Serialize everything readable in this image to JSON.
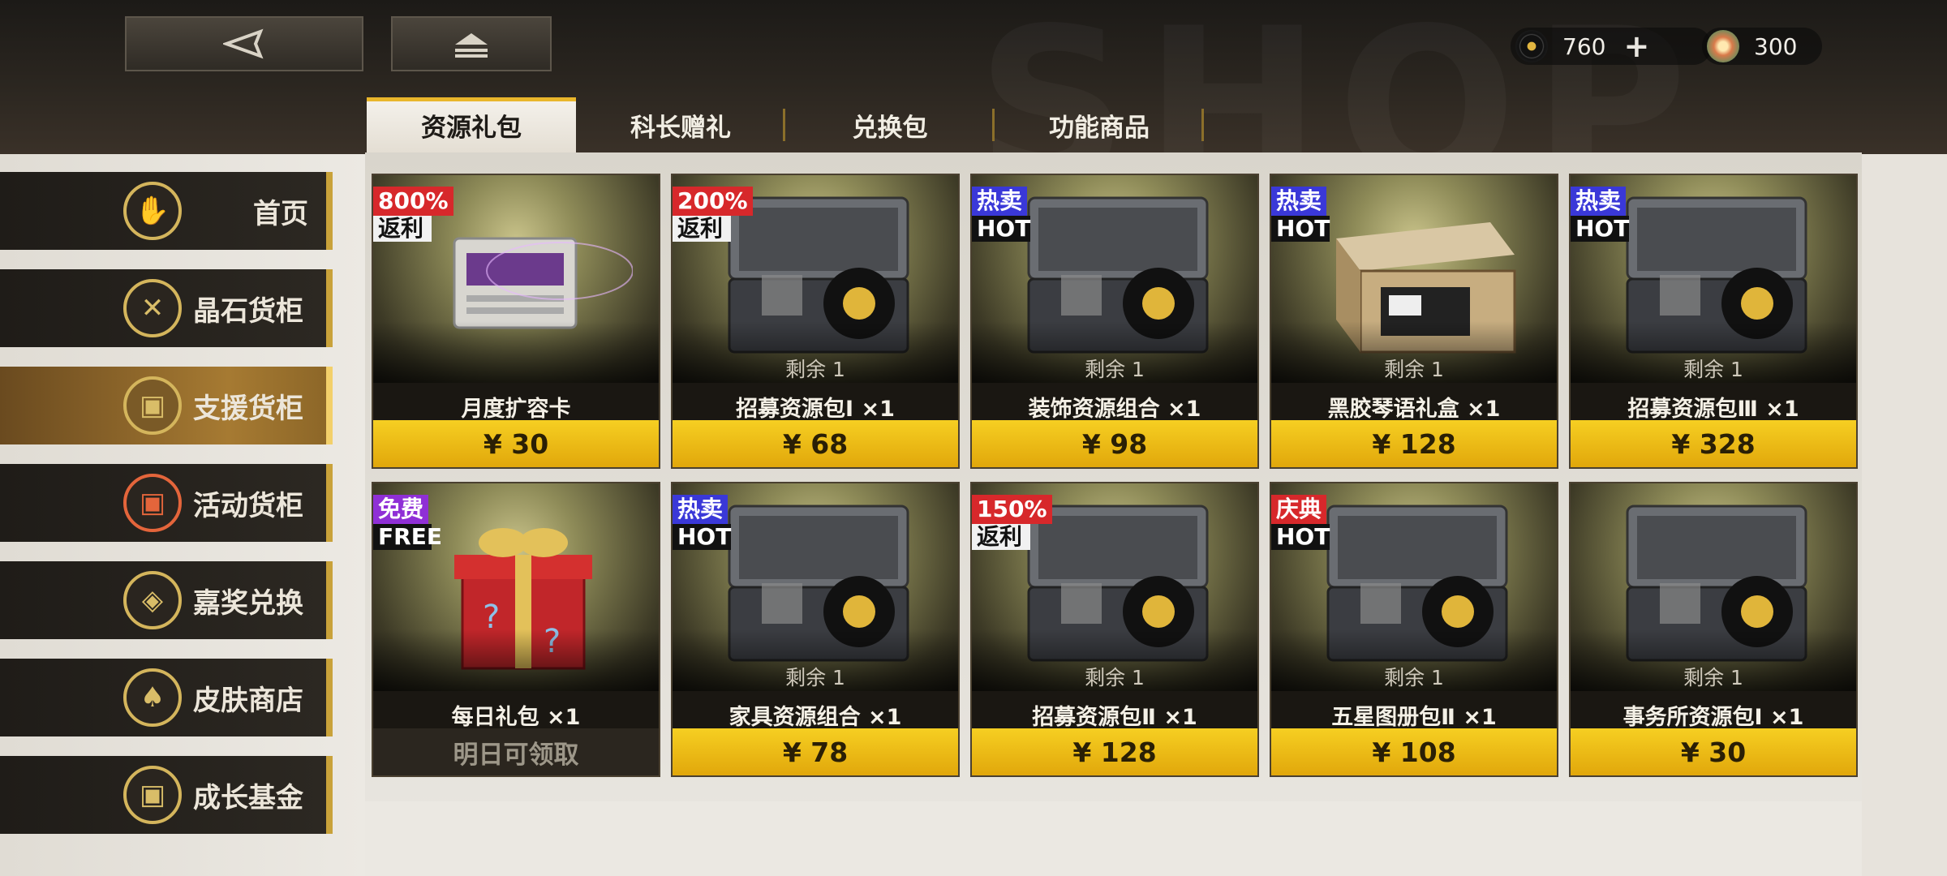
{
  "header": {
    "back_icon": "back-triangle-icon",
    "home_icon": "home-eject-icon",
    "bg_text": "SHOP",
    "currencies": [
      {
        "icon": "vinyl-record-icon",
        "value": "760",
        "plus": "+"
      },
      {
        "icon": "crystal-gem-icon",
        "value": "300"
      }
    ]
  },
  "tabs": [
    {
      "label": "资源礼包",
      "active": true
    },
    {
      "label": "科长赠礼",
      "active": false
    },
    {
      "label": "兑换包",
      "active": false
    },
    {
      "label": "功能商品",
      "active": false
    }
  ],
  "sidebar": {
    "items": [
      {
        "label": "首页",
        "icon": "home-hand-icon",
        "active": false
      },
      {
        "label": "晶石货柜",
        "icon": "crystal-cross-icon",
        "active": false
      },
      {
        "label": "支援货柜",
        "icon": "support-box-icon",
        "active": true
      },
      {
        "label": "活动货柜",
        "icon": "event-box-icon",
        "active": false
      },
      {
        "label": "嘉奖兑换",
        "icon": "reward-emblem-icon",
        "active": false
      },
      {
        "label": "皮肤商店",
        "icon": "suit-icon",
        "active": false
      },
      {
        "label": "成长基金",
        "icon": "fund-box-icon",
        "active": false
      }
    ]
  },
  "products": [
    {
      "badge_top": "800%",
      "badge_bottom": "返利",
      "badge_color": "red",
      "remaining": "",
      "name": "月度扩容卡",
      "price": "¥ 30",
      "art": "cartridge"
    },
    {
      "badge_top": "200%",
      "badge_bottom": "返利",
      "badge_color": "red",
      "remaining": "剩余 1",
      "name": "招募资源包Ⅰ ×1",
      "price": "¥ 68",
      "art": "case"
    },
    {
      "badge_top": "热卖",
      "badge_bottom": "HOT",
      "badge_color": "blue",
      "remaining": "剩余 1",
      "name": "装饰资源组合 ×1",
      "price": "¥ 98",
      "art": "case"
    },
    {
      "badge_top": "热卖",
      "badge_bottom": "HOT",
      "badge_color": "blue",
      "remaining": "剩余 1",
      "name": "黑胶琴语礼盒 ×1",
      "price": "¥ 128",
      "art": "box"
    },
    {
      "badge_top": "热卖",
      "badge_bottom": "HOT",
      "badge_color": "blue",
      "remaining": "剩余 1",
      "name": "招募资源包Ⅲ ×1",
      "price": "¥ 328",
      "art": "case"
    },
    {
      "badge_top": "免费",
      "badge_bottom": "FREE",
      "badge_color": "purple",
      "remaining": "",
      "name": "每日礼包 ×1",
      "price": "明日可领取",
      "art": "gift"
    },
    {
      "badge_top": "热卖",
      "badge_bottom": "HOT",
      "badge_color": "blue",
      "remaining": "剩余 1",
      "name": "家具资源组合 ×1",
      "price": "¥ 78",
      "art": "case"
    },
    {
      "badge_top": "150%",
      "badge_bottom": "返利",
      "badge_color": "red",
      "remaining": "剩余 1",
      "name": "招募资源包Ⅱ ×1",
      "price": "¥ 128",
      "art": "case"
    },
    {
      "badge_top": "庆典",
      "badge_bottom": "HOT",
      "badge_color": "red",
      "remaining": "剩余 1",
      "name": "五星图册包Ⅱ ×1",
      "price": "¥ 108",
      "art": "case"
    },
    {
      "badge_top": "",
      "badge_bottom": "",
      "badge_color": "",
      "remaining": "剩余 1",
      "name": "事务所资源包Ⅰ ×1",
      "price": "¥ 30",
      "art": "case"
    }
  ],
  "colors": {
    "accent_gold": "#e9b62b",
    "price_yellow": "#f6cf22",
    "badge_red": "#d7282b",
    "badge_blue": "#3a38d8",
    "badge_purple": "#8f2fd6"
  }
}
